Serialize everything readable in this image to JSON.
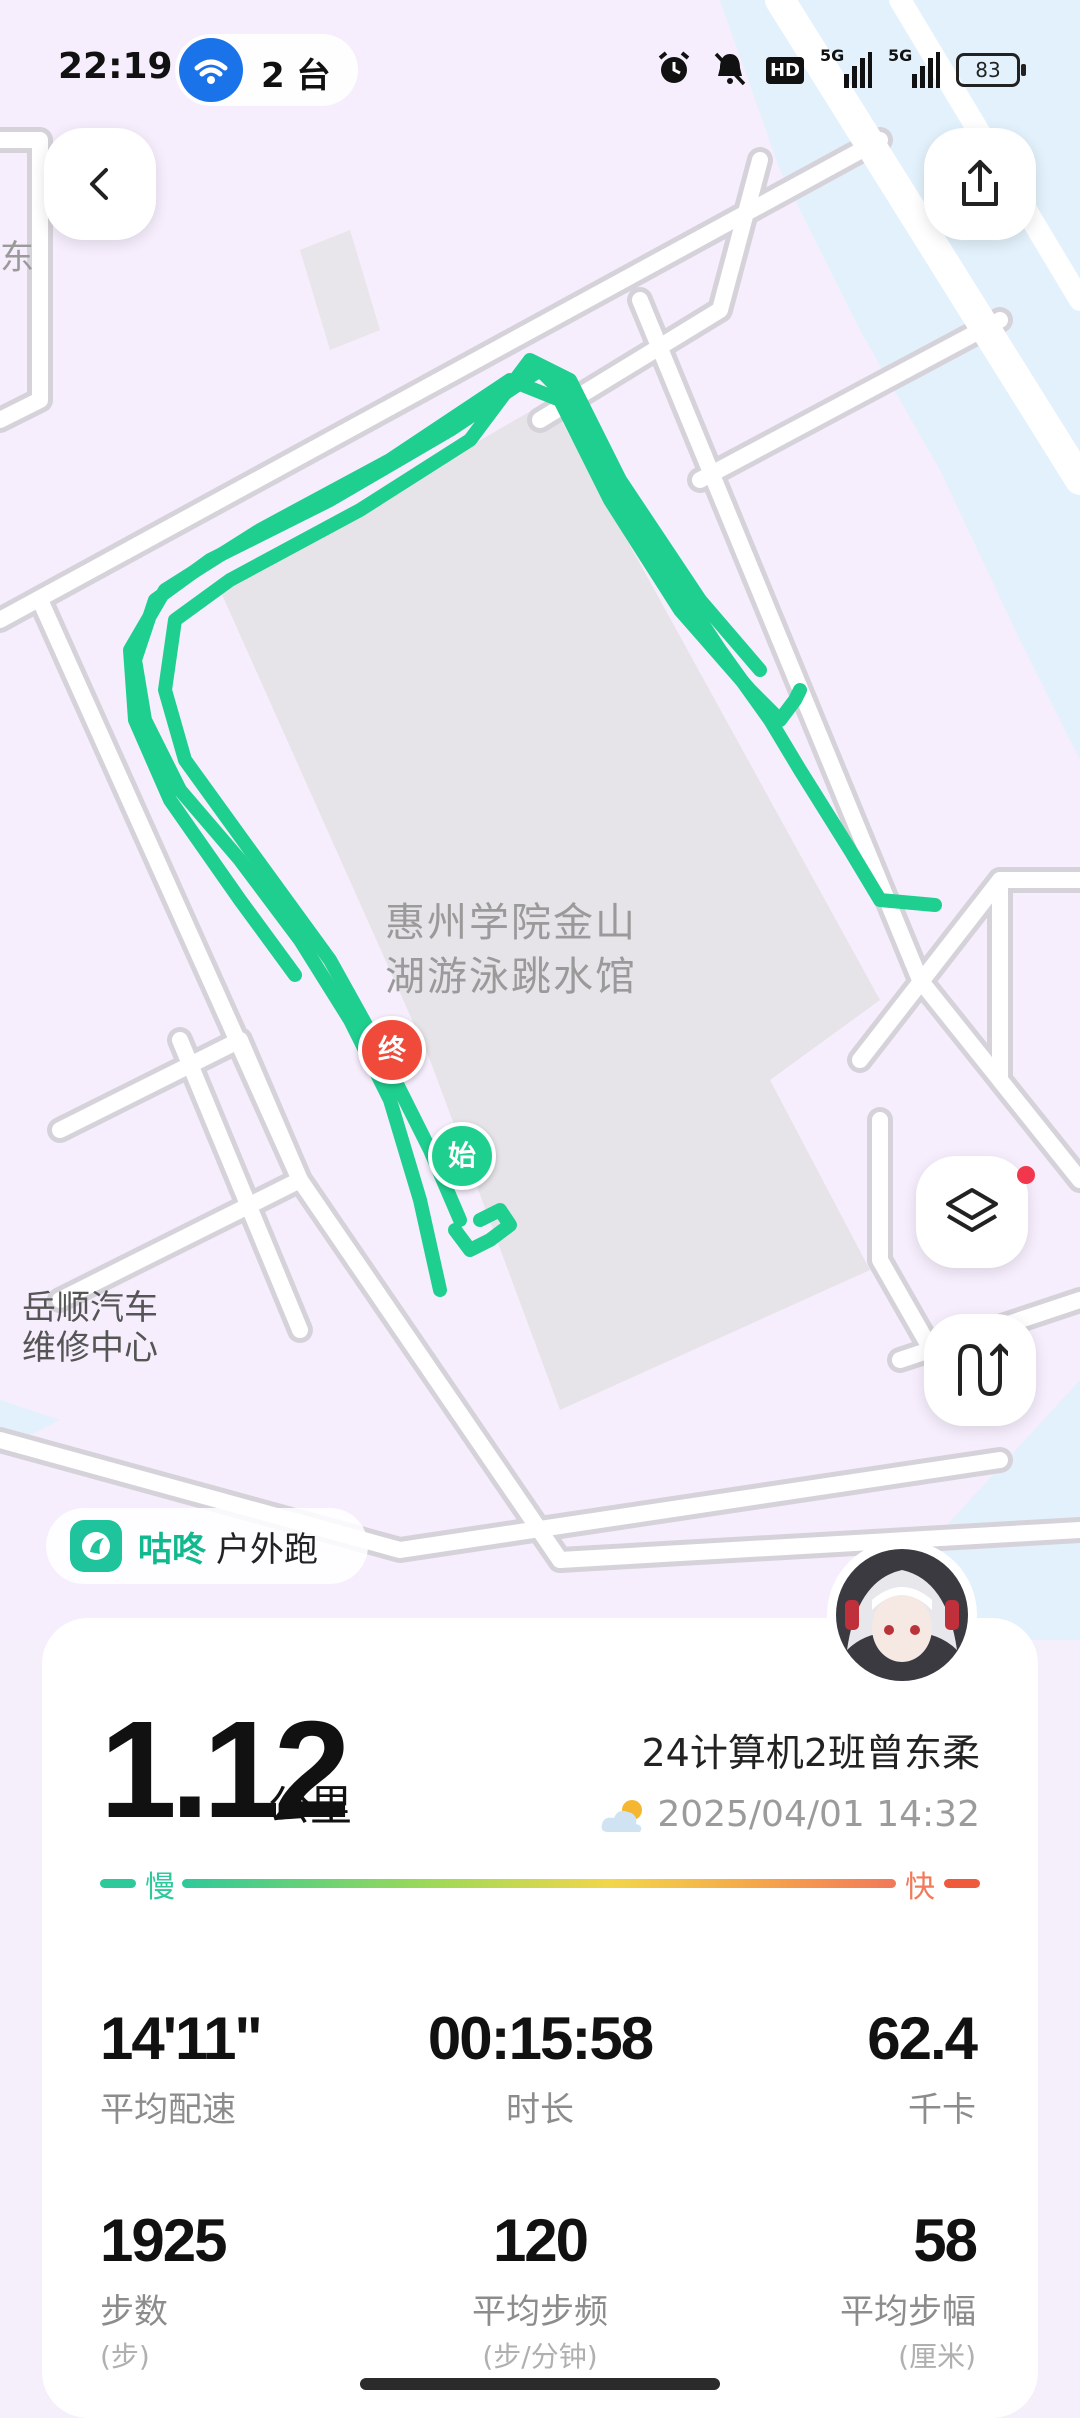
{
  "status_bar": {
    "time": "22:19",
    "hotspot_count": "2 台",
    "icons": [
      "alarm-icon",
      "mute-icon",
      "hd-icon",
      "signal-5g-icon",
      "signal-5g-icon"
    ],
    "hd_label": "HD",
    "network_label_1": "5G",
    "network_label_2": "5G",
    "battery": "83"
  },
  "map": {
    "venue_line1": "惠州学院金山",
    "venue_line2": "湖游泳跳水馆",
    "poi_line1": "岳顺汽车",
    "poi_line2": "维修中心",
    "corner_text": "东",
    "start_label": "始",
    "end_label": "终",
    "route_color": "#1fcf8f"
  },
  "app": {
    "name": "咕咚",
    "mode": "户外跑"
  },
  "summary": {
    "distance": "1.12",
    "distance_unit": "公里",
    "user": "24计算机2班曾东柔",
    "datetime": "2025/04/01 14:32",
    "slow_label": "慢",
    "fast_label": "快"
  },
  "stats": [
    {
      "value": "14'11\"",
      "label": "平均配速",
      "unit": ""
    },
    {
      "value": "00:15:58",
      "label": "时长",
      "unit": ""
    },
    {
      "value": "62.4",
      "label": "千卡",
      "unit": ""
    },
    {
      "value": "1925",
      "label": "步数",
      "unit": "(步)"
    },
    {
      "value": "120",
      "label": "平均步频",
      "unit": "(步/分钟)"
    },
    {
      "value": "58",
      "label": "平均步幅",
      "unit": "(厘米)"
    }
  ]
}
